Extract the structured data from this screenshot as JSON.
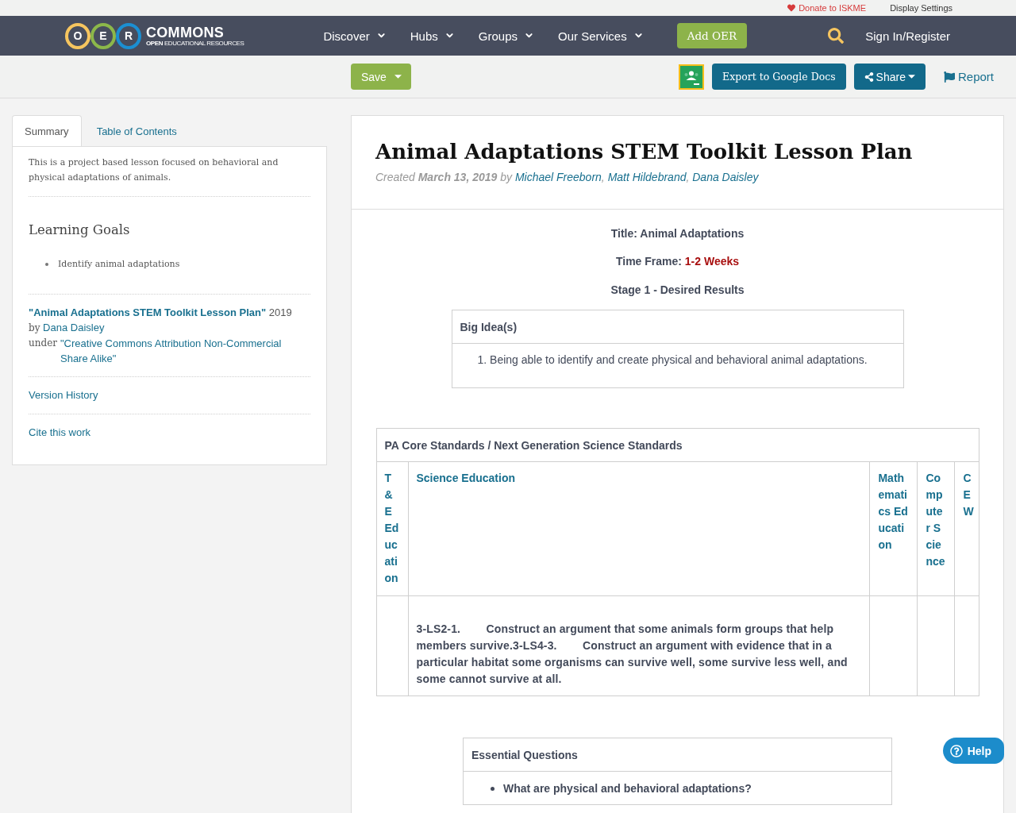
{
  "top_bar": {
    "donate": "Donate to ISKME",
    "display_settings": "Display Settings"
  },
  "logo": {
    "letters": [
      {
        "letter": "O",
        "color": "#f6c55f"
      },
      {
        "letter": "E",
        "color": "#8cb84a"
      },
      {
        "letter": "R",
        "color": "#1b8fd2"
      }
    ],
    "wordmark": "COMMONS",
    "tagline": "**OPEN** EDUCATIONAL RESOURCES"
  },
  "nav": {
    "items": [
      {
        "label": "Discover",
        "dropdown": true
      },
      {
        "label": "Hubs",
        "dropdown": true
      },
      {
        "label": "Groups",
        "dropdown": true
      },
      {
        "label": "Our Services",
        "dropdown": true
      }
    ],
    "add_button": "Add OER",
    "sign_in": "Sign In/Register"
  },
  "toolbar": {
    "save": "Save",
    "export": "Export to Google Docs",
    "share": "Share",
    "report": "Report"
  },
  "sidebar": {
    "tabs": [
      {
        "label": "Summary",
        "selected": true
      },
      {
        "label": "Table of Contents",
        "selected": false
      }
    ],
    "summary": "This is a project based lesson focused on behavioral and physical adaptations of animals.",
    "goals_heading": "Learning Goals",
    "goals": [
      "Identify animal adaptations"
    ],
    "attribution": {
      "title": "\"Animal Adaptations STEM Toolkit Lesson Plan\"",
      "year": "2019",
      "by": "by",
      "author": "Dana Daisley",
      "under": "under",
      "license": "\"Creative Commons Attribution Non-Commercial Share Alike\""
    },
    "links": [
      "Version History",
      "Cite this work"
    ]
  },
  "resource": {
    "title": "Animal Adaptations STEM Toolkit Lesson Plan",
    "byline": {
      "created": "Created",
      "date": "March 13, 2019",
      "by": "by",
      "authors": [
        "Michael Freeborn",
        "Matt Hildebrand",
        "Dana Daisley"
      ],
      "separator": ","
    },
    "lesson_title": "Title: Animal Adaptations",
    "time_frame": {
      "label": "Time Frame:",
      "value": "1-2 Weeks"
    },
    "stage": "Stage 1 - Desired Results",
    "big_ideas": {
      "heading": "Big Idea(s)",
      "items": [
        "1. Being able to identify and create physical and behavioral animal adaptations."
      ]
    },
    "standards": {
      "heading": "PA Core Standards / Next Generation Science Standards",
      "columns": [
        {
          "heading": "T & E Education"
        },
        {
          "heading": "Science Education",
          "entries": [
            "3-LS2-1.        Construct an argument that some animals form groups that help members survive.3-LS4-3.        Construct an argument with evidence that in a particular habitat some organisms can survive well, some survive less well, and some cannot survive at all."
          ]
        },
        {
          "heading": "Mathematics Education"
        },
        {
          "heading": "Computer Science"
        },
        {
          "heading": "CEW"
        }
      ]
    },
    "essential_questions": {
      "heading": "Essential Questions",
      "items": [
        "What are physical and behavioral adaptations?"
      ]
    }
  },
  "help": "Help"
}
